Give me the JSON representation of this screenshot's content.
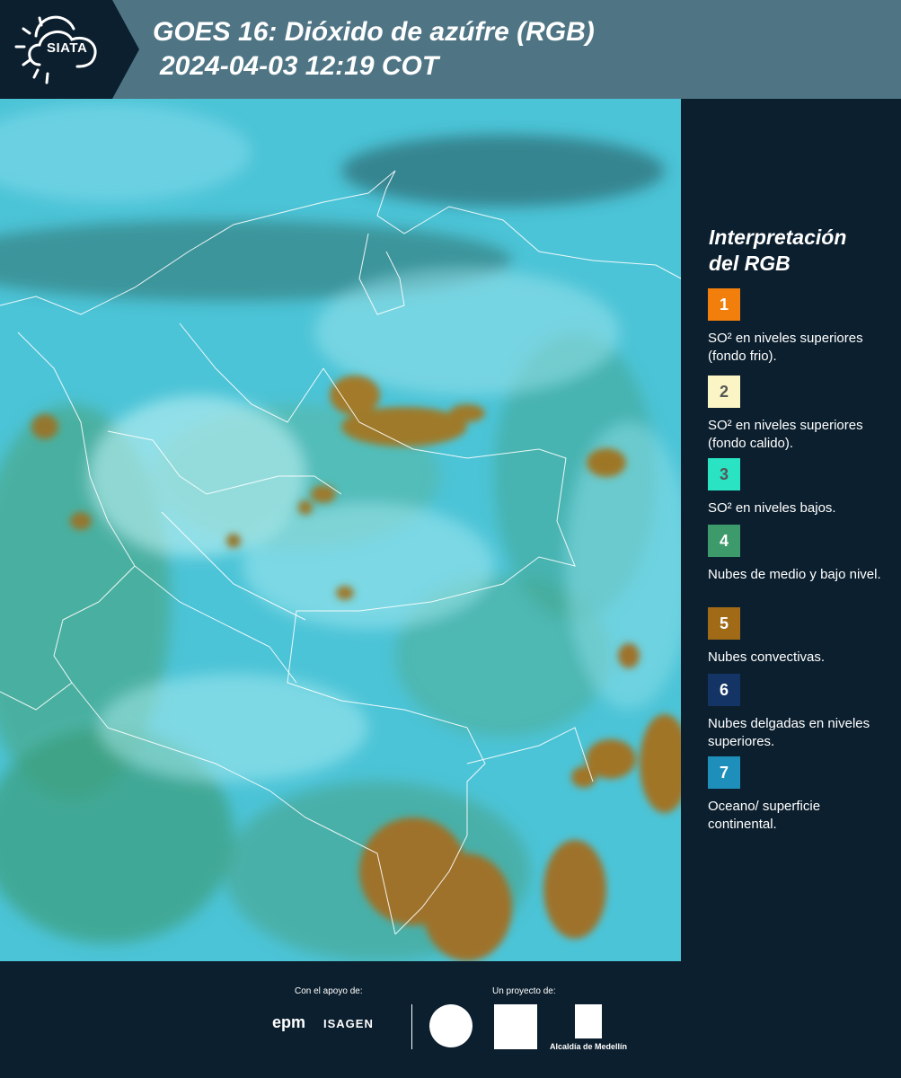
{
  "header": {
    "logo_text": "SIATA",
    "title": "GOES 16: Dióxido de azúfre (RGB)",
    "timestamp": "2024-04-03 12:19 COT"
  },
  "legend": {
    "title_line1": "Interpretación",
    "title_line2": "del RGB",
    "items": [
      {
        "number": "1",
        "label": "SO² en niveles superiores (fondo frio).",
        "color": "#f27f0c",
        "text_color": "#ffffff"
      },
      {
        "number": "2",
        "label": "SO² en niveles superiores (fondo calido).",
        "color": "#fbf5c6",
        "text_color": "#555555"
      },
      {
        "number": "3",
        "label": "SO² en niveles bajos.",
        "color": "#29e3c3",
        "text_color": "#555555"
      },
      {
        "number": "4",
        "label": "Nubes de medio y bajo nivel.",
        "color": "#3d9a6a",
        "text_color": "#ffffff"
      },
      {
        "number": "5",
        "label": "Nubes convectivas.",
        "color": "#a06a16",
        "text_color": "#ffffff"
      },
      {
        "number": "6",
        "label": "Nubes delgadas en niveles superiores.",
        "color": "#143466",
        "text_color": "#ffffff"
      },
      {
        "number": "7",
        "label": "Oceano/ superficie continental.",
        "color": "#1e8fba",
        "text_color": "#ffffff"
      }
    ]
  },
  "footer": {
    "support_label": "Con el apoyo de:",
    "project_label": "Un proyecto de:",
    "sponsor1": "epm",
    "sponsor2": "ISAGEN",
    "partner3": "Alcaldía de Medellín"
  }
}
